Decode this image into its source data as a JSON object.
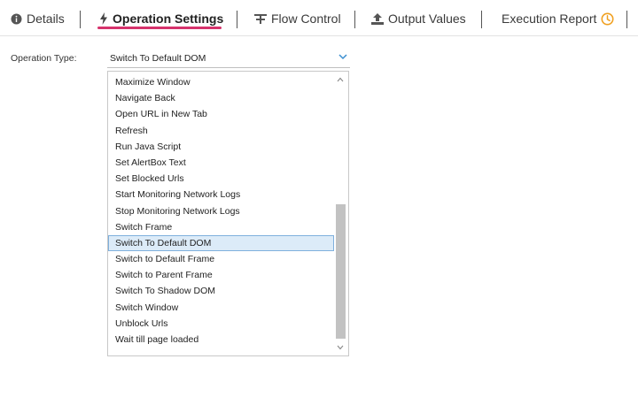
{
  "tabs": [
    {
      "label": "Details",
      "icon": "info-icon"
    },
    {
      "label": "Operation Settings",
      "icon": "bolt-icon",
      "active": true
    },
    {
      "label": "Flow Control",
      "icon": "flow-control-icon"
    },
    {
      "label": "Output Values",
      "icon": "upload-icon"
    },
    {
      "label": "Execution Report",
      "icon": "clock-icon"
    }
  ],
  "colors": {
    "accent_underline": "#d6336c",
    "clock_icon": "#f0a020",
    "selection_bg": "#dcebf8",
    "selection_border": "#7fb0dd",
    "combo_chevron": "#3c8fd0"
  },
  "operation_type": {
    "label": "Operation Type:",
    "selected_value": "Switch To Default DOM",
    "options": [
      "Maximize Window",
      "Navigate Back",
      "Open URL in New Tab",
      "Refresh",
      "Run Java Script",
      "Set AlertBox Text",
      "Set Blocked Urls",
      "Start Monitoring Network Logs",
      "Stop Monitoring Network Logs",
      "Switch Frame",
      "Switch To Default DOM",
      "Switch to Default Frame",
      "Switch to Parent Frame",
      "Switch To Shadow DOM",
      "Switch Window",
      "Unblock Urls",
      "Wait till page loaded"
    ],
    "selected_index": 10
  }
}
